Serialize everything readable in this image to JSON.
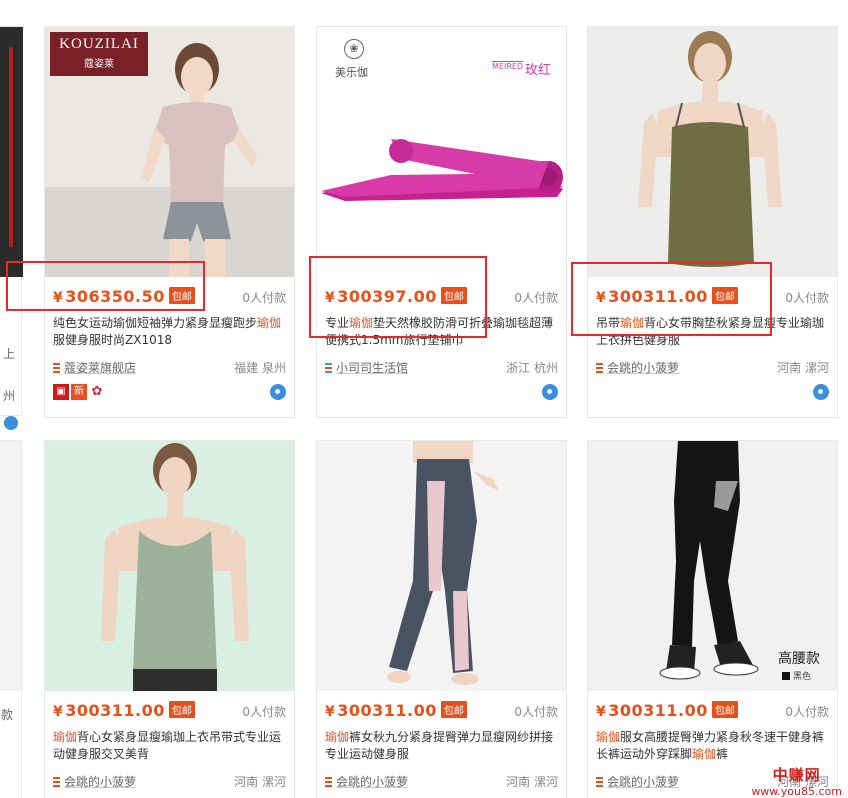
{
  "common": {
    "baoyou": "包邮",
    "paid": "0人付款",
    "yen": "¥"
  },
  "products": [
    {
      "price": "306350.50",
      "title_pre": "纯色女运动瑜伽短袖弹力紧身显瘦跑步",
      "title_hl": "瑜伽",
      "title_post": "服健身服时尚ZX1018",
      "shop": "蔻姿莱旗舰店",
      "location": "福建 泉州",
      "brand_logo": "KOUZILAI",
      "brand_logo_cn": "蔻姿莱",
      "badge_new": "新"
    },
    {
      "price": "300397.00",
      "title_pre": "专业",
      "title_hl": "瑜伽",
      "title_post": "垫天然橡胶防滑可折叠瑜珈毯超薄便携式1.5mm旅行垫铺巾",
      "shop": "小司司生活馆",
      "location": "浙江 杭州",
      "brand_small": "美乐伽",
      "color_brand": "MEIRED",
      "color_name": "玫红"
    },
    {
      "price": "300311.00",
      "title_pre": "吊带",
      "title_hl": "瑜伽",
      "title_post": "背心女带胸垫秋紧身显瘦专业瑜珈上衣拼色健身服",
      "shop": "会跳的小菠萝",
      "location": "河南 漯河"
    },
    {
      "price": "300311.00",
      "title_pre": "",
      "title_hl": "瑜伽",
      "title_post": "背心女紧身显瘦瑜珈上衣吊带式专业运动健身服交叉美背",
      "shop": "会跳的小菠萝",
      "location": "河南 漯河"
    },
    {
      "price": "300311.00",
      "title_pre": "",
      "title_hl": "瑜伽",
      "title_post": "裤女秋九分紧身提臀弹力显瘦网纱拼接专业运动健身服",
      "shop": "会跳的小菠萝",
      "location": "河南 漯河"
    },
    {
      "price": "300311.00",
      "title_pre": "",
      "title_hl": "瑜伽",
      "title_post": "服女高腰提臀弹力紧身秋冬速干健身裤长裤运动外穿踩脚",
      "title_hl2": "瑜伽",
      "title_post2": "裤",
      "shop": "会跳的小菠萝",
      "location": "河南 漯河",
      "tag_main": "高腰款",
      "tag_sub": "黑色"
    }
  ],
  "left_edge": {
    "paid_partial": "款",
    "left_text_1": "上",
    "left_text_2": "州"
  },
  "watermark": {
    "line1": "中赚网",
    "line2": "www.you85.com"
  },
  "colors": {
    "price": "#e5511d",
    "highlight_box": "#e52a2a",
    "link_blue": "#3a8fd9"
  }
}
